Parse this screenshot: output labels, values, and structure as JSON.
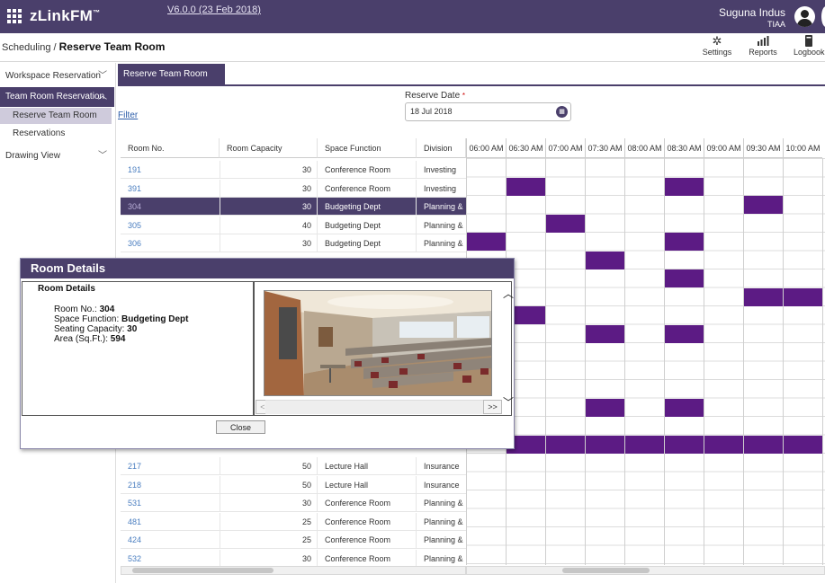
{
  "header": {
    "brand": "zLinkFM",
    "brand_tm": "™",
    "version": "V6.0.0 (23 Feb 2018)",
    "user_name": "Suguna Indus",
    "user_org": "TIAA"
  },
  "breadcrumb": {
    "parent": "Scheduling",
    "separator": " / ",
    "current": "Reserve Team Room"
  },
  "toolbar": {
    "settings": "Settings",
    "reports": "Reports",
    "logbook": "Logbook"
  },
  "sidebar": {
    "workspace_reservation": "Workspace Reservation",
    "team_room_reservation": "Team Room Reservation",
    "reserve_team_room": "Reserve Team Room",
    "reservations": "Reservations",
    "drawing_view": "Drawing View"
  },
  "tab": {
    "label": "Reserve Team Room"
  },
  "filter_label": "Filter",
  "reserve_date": {
    "label": "Reserve Date",
    "required_mark": "*",
    "value": "18 Jul 2018"
  },
  "table": {
    "headers": [
      "Room No.",
      "Room Capacity",
      "Space Function",
      "Division"
    ],
    "time_slots": [
      "06:00 AM",
      "06:30 AM",
      "07:00 AM",
      "07:30 AM",
      "08:00 AM",
      "08:30 AM",
      "09:00 AM",
      "09:30 AM",
      "10:00 AM"
    ],
    "rows_top": [
      {
        "room": "191",
        "capacity": "30",
        "function": "Conference Room",
        "division": "Investing"
      },
      {
        "room": "391",
        "capacity": "30",
        "function": "Conference Room",
        "division": "Investing"
      },
      {
        "room": "304",
        "capacity": "30",
        "function": "Budgeting Dept",
        "division": "Planning &",
        "selected": true
      },
      {
        "room": "305",
        "capacity": "40",
        "function": "Budgeting Dept",
        "division": "Planning &"
      },
      {
        "room": "306",
        "capacity": "30",
        "function": "Budgeting Dept",
        "division": "Planning &"
      }
    ],
    "rows_bottom": [
      {
        "room": "217",
        "capacity": "50",
        "function": "Lecture Hall",
        "division": "Insurance"
      },
      {
        "room": "218",
        "capacity": "50",
        "function": "Lecture Hall",
        "division": "Insurance"
      },
      {
        "room": "531",
        "capacity": "30",
        "function": "Conference Room",
        "division": "Planning &"
      },
      {
        "room": "481",
        "capacity": "25",
        "function": "Conference Room",
        "division": "Planning &"
      },
      {
        "room": "424",
        "capacity": "25",
        "function": "Conference Room",
        "division": "Planning &"
      },
      {
        "room": "532",
        "capacity": "30",
        "function": "Conference Room",
        "division": "Planning &"
      }
    ]
  },
  "schedule": {
    "color": "#5c1b84",
    "booked": [
      {
        "row": 1,
        "slot": 1
      },
      {
        "row": 1,
        "slot": 5
      },
      {
        "row": 2,
        "slot": 7
      },
      {
        "row": 3,
        "slot": 2
      },
      {
        "row": 4,
        "slot": 0
      },
      {
        "row": 4,
        "slot": 5
      },
      {
        "row": 5,
        "slot": 3
      },
      {
        "row": 6,
        "slot": 5
      },
      {
        "row": 7,
        "slot": 7
      },
      {
        "row": 7,
        "slot": 8
      },
      {
        "row": 8,
        "slot": 1
      },
      {
        "row": 9,
        "slot": 3
      },
      {
        "row": 9,
        "slot": 5
      },
      {
        "row": 13,
        "slot": 3
      },
      {
        "row": 13,
        "slot": 5
      },
      {
        "row": 15,
        "slot": 1
      },
      {
        "row": 15,
        "slot": 2
      },
      {
        "row": 15,
        "slot": 3
      },
      {
        "row": 15,
        "slot": 4
      },
      {
        "row": 15,
        "slot": 5
      },
      {
        "row": 15,
        "slot": 6
      },
      {
        "row": 15,
        "slot": 7
      },
      {
        "row": 15,
        "slot": 8
      }
    ]
  },
  "dialog": {
    "title": "Room Details",
    "section": "Room Details",
    "room_no_label": "Room No.:",
    "room_no": "304",
    "space_function_label": "Space Function:",
    "space_function": "Budgeting Dept",
    "seating_capacity_label": "Seating Capacity:",
    "seating_capacity": "30",
    "area_label": "Area (Sq.Ft.):",
    "area": "594",
    "prev": "<<",
    "next": ">>",
    "close": "Close"
  }
}
